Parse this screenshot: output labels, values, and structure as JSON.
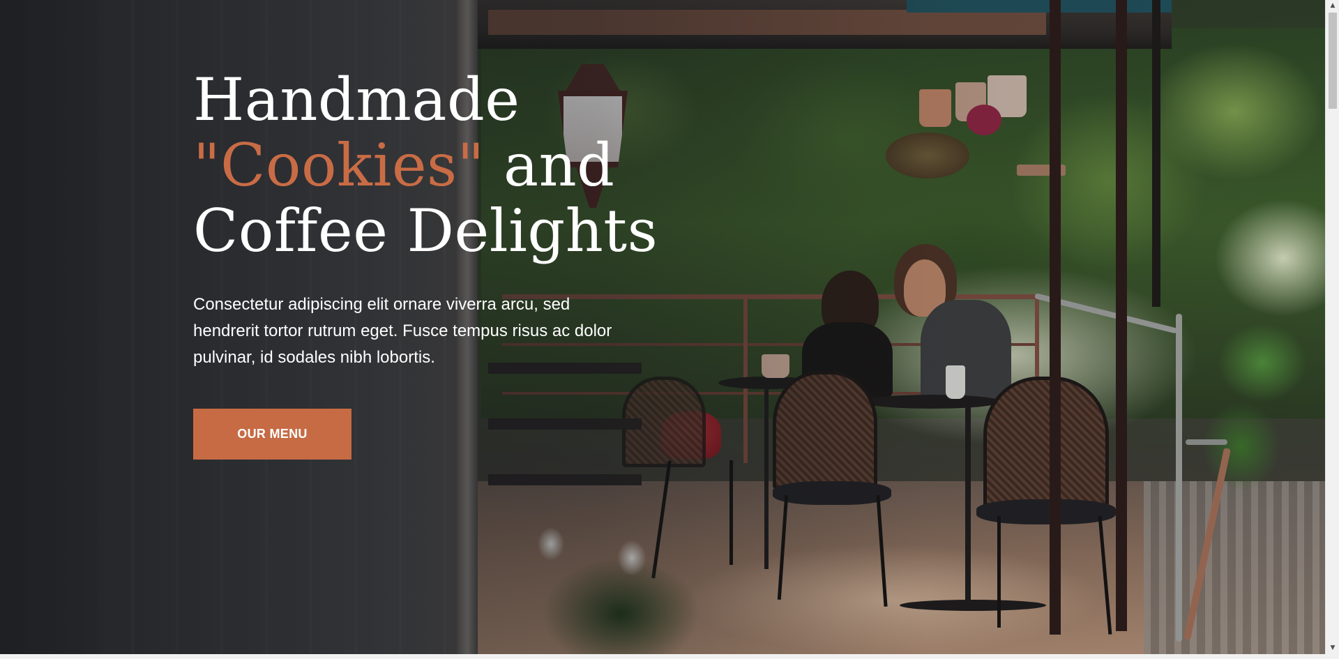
{
  "hero": {
    "title_line1": "Handmade",
    "title_highlight": "\"Cookies\"",
    "title_line2_rest": "and",
    "title_line3": "Coffee Delights",
    "description": "Consectetur adipiscing elit ornare viverra arcu, sed hendrerit tortor rutrum eget. Fusce tempus risus ac dolor pulvinar, id sodales nibh lobortis.",
    "button_label": "OUR MENU"
  },
  "scrollbar": {
    "up_icon": "▲",
    "down_icon": "▼"
  },
  "colors": {
    "accent": "#c96c45",
    "button": "#c66b44",
    "text": "#ffffff"
  },
  "icons": {
    "scroll_up": "triangle-up-icon",
    "scroll_down": "triangle-down-icon"
  }
}
